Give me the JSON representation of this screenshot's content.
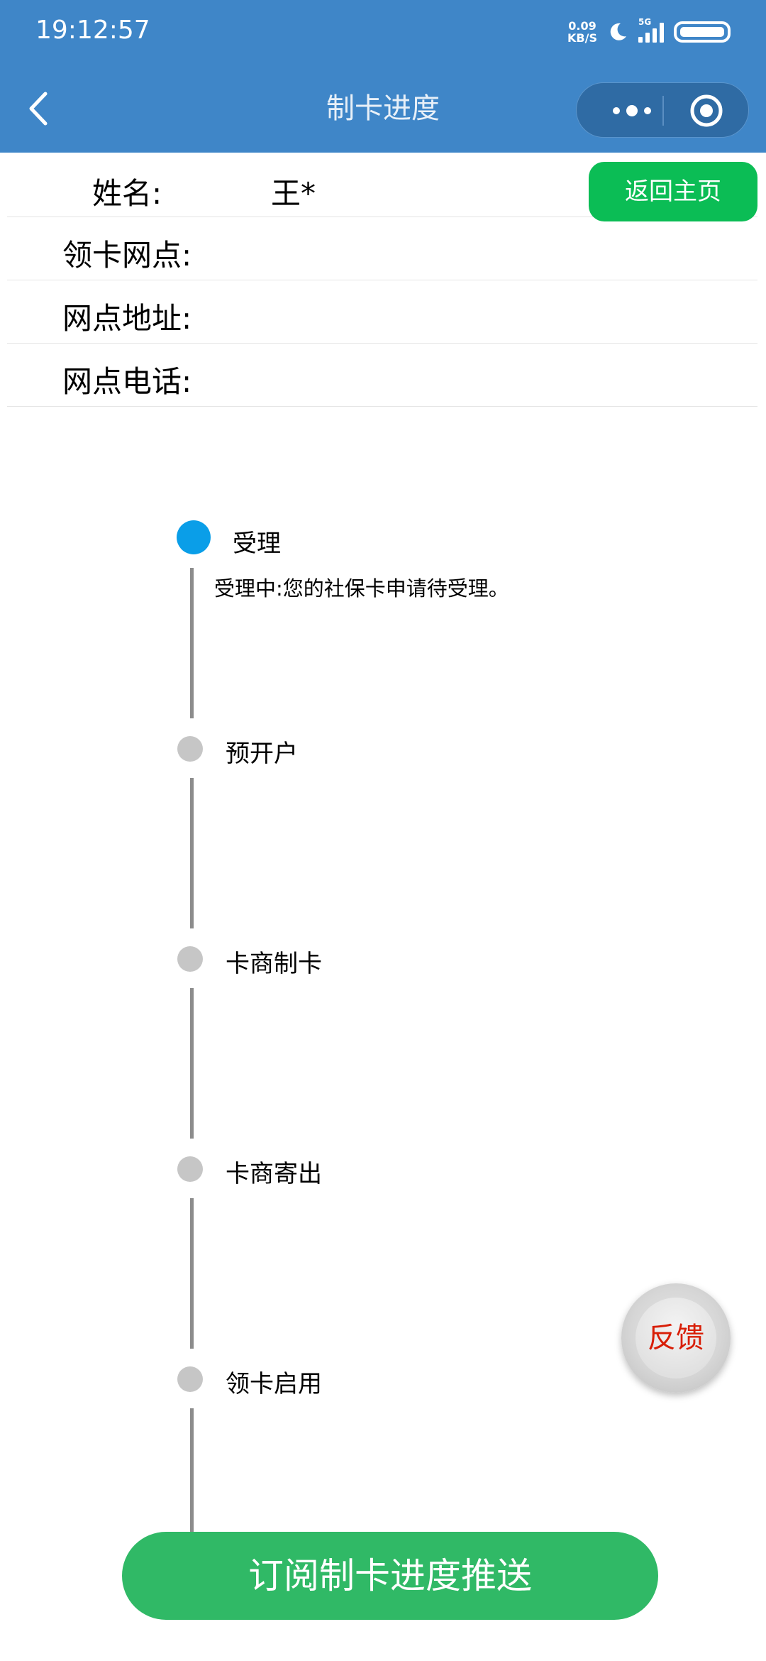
{
  "status_bar": {
    "time": "19:12:57",
    "net_speed_value": "0.09",
    "net_speed_unit": "KB/S",
    "network_type": "5G"
  },
  "nav": {
    "title": "制卡进度"
  },
  "info": {
    "name_label": "姓名:",
    "name_value": "王*",
    "branch_label": "领卡网点:",
    "address_label": "网点地址:",
    "phone_label": "网点电话:",
    "home_button": "返回主页"
  },
  "timeline": {
    "steps": [
      {
        "label": "受理",
        "status": "active",
        "description": "受理中:您的社保卡申请待受理。"
      },
      {
        "label": "预开户",
        "status": "pending"
      },
      {
        "label": "卡商制卡",
        "status": "pending"
      },
      {
        "label": "卡商寄出",
        "status": "pending"
      },
      {
        "label": "领卡启用",
        "status": "pending"
      }
    ]
  },
  "feedback_button": "反馈",
  "subscribe_button": "订阅制卡进度推送",
  "colors": {
    "nav_bg": "#3f86c8",
    "primary_green": "#0bbd55",
    "active_dot": "#0a9ee8",
    "pending_dot": "#c6c6c6",
    "feedback_text": "#d81e06"
  }
}
